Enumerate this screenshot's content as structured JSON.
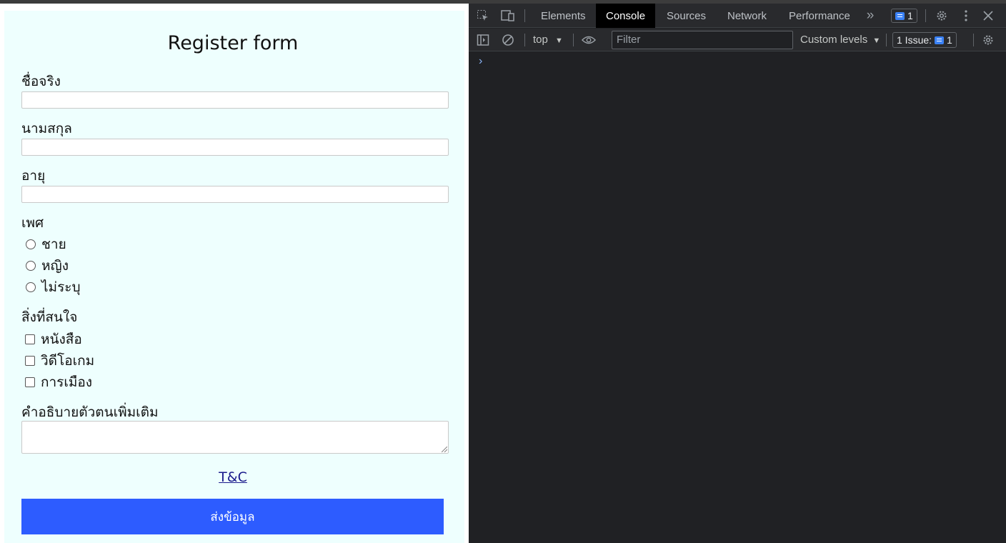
{
  "form": {
    "title": "Register form",
    "first_name_label": "ชื่อจริง",
    "last_name_label": "นามสกุล",
    "age_label": "อายุ",
    "gender_label": "เพศ",
    "gender_options": [
      "ชาย",
      "หญิง",
      "ไม่ระบุ"
    ],
    "interests_label": "สิ่งที่สนใจ",
    "interest_options": [
      "หนังสือ",
      "วิดีโอเกม",
      "การเมือง"
    ],
    "description_label": "คำอธิบายตัวตนเพิ่มเติม",
    "tc_link": "T&C",
    "submit_label": "ส่งข้อมูล"
  },
  "devtools": {
    "tabs": [
      "Elements",
      "Console",
      "Sources",
      "Network",
      "Performance"
    ],
    "active_tab": "Console",
    "more_tabs": "»",
    "message_count": "1",
    "context": "top",
    "filter_placeholder": "Filter",
    "levels": "Custom levels",
    "issues_label": "1 Issue:",
    "issues_count": "1",
    "prompt_symbol": "›"
  },
  "colors": {
    "form_bg": "#eefffe",
    "submit_bg": "#2d5cff",
    "devtools_bg": "#202124",
    "link": "#1a1a8c"
  }
}
